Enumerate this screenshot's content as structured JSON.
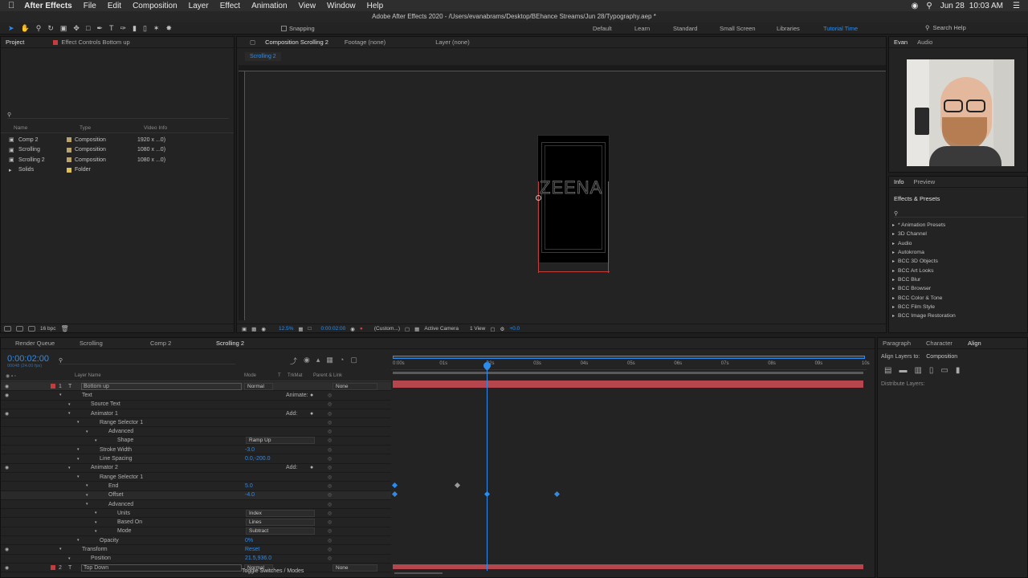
{
  "menubar": {
    "app": "After Effects",
    "items": [
      "File",
      "Edit",
      "Composition",
      "Layer",
      "Effect",
      "Animation",
      "View",
      "Window",
      "Help"
    ],
    "date": "Jun 28",
    "time": "10:03 AM"
  },
  "title": "Adobe After Effects 2020 - /Users/evanabrams/Desktop/BEhance Streams/Jun 28/Typography.aep *",
  "toolbar": {
    "snapping": "Snapping",
    "workspaces": [
      "Default",
      "Learn",
      "Standard",
      "Small Screen",
      "Libraries",
      "Tutorial Time"
    ],
    "search": "Search Help"
  },
  "project": {
    "tab": "Project",
    "effects_tab": "Effect Controls Bottom up",
    "cols": [
      "Name",
      "Type",
      "Video Info"
    ],
    "items": [
      {
        "name": "Comp 2",
        "type": "Composition",
        "info": "1920 x ...0)"
      },
      {
        "name": "Scrolling",
        "type": "Composition",
        "info": "1080 x ...0)"
      },
      {
        "name": "Scrolling 2",
        "type": "Composition",
        "info": "1080 x ...0)"
      },
      {
        "name": "Solids",
        "type": "Folder",
        "info": ""
      }
    ],
    "bpc": "16 bpc"
  },
  "comp": {
    "tab": "Composition Scrolling 2",
    "footage": "Footage (none)",
    "layer": "Layer (none)",
    "subtab": "Scrolling 2",
    "text": "ZEENA",
    "zoom": "12.5%",
    "timecode": "0:00:02:00",
    "res": "(Custom...)",
    "camera": "Active Camera",
    "view": "1 View",
    "exposure": "+0.0"
  },
  "right": {
    "user": "Evan",
    "audio": "Audio",
    "info": "Info",
    "preview": "Preview",
    "effects": "Effects & Presets",
    "presets": [
      "* Animation Presets",
      "3D Channel",
      "Audio",
      "Autokroma",
      "BCC 3D Objects",
      "BCC Art Looks",
      "BCC Blur",
      "BCC Browser",
      "BCC Color & Tone",
      "BCC Film Style",
      "BCC Image Restoration"
    ],
    "paragraph": "Paragraph",
    "character": "Character",
    "align": "Align",
    "align_to": "Align Layers to:",
    "align_val": "Composition",
    "distribute": "Distribute Layers:"
  },
  "timeline": {
    "tabs": [
      "Render Queue",
      "Scrolling",
      "Comp 2",
      "Scrolling 2"
    ],
    "timecode": "0:00:02:00",
    "frames": "00048 (24.00 fps)",
    "cols": [
      "Layer Name",
      "Mode",
      "T",
      "TrkMat",
      "Parent & Link"
    ],
    "ruler": [
      "0:00s",
      "01s",
      "02s",
      "03s",
      "04s",
      "05s",
      "06s",
      "07s",
      "08s",
      "09s",
      "10s"
    ],
    "rows": [
      {
        "indent": 0,
        "label": "Bottom up",
        "num": "1",
        "mode": "Normal",
        "parent": "None",
        "layer": true
      },
      {
        "indent": 1,
        "label": "Text",
        "right": "Animate:"
      },
      {
        "indent": 2,
        "label": "Source Text"
      },
      {
        "indent": 2,
        "label": "Animator 1",
        "right": "Add:"
      },
      {
        "indent": 3,
        "label": "Range Selector 1"
      },
      {
        "indent": 4,
        "label": "Advanced"
      },
      {
        "indent": 5,
        "label": "Shape",
        "val": "Ramp Up",
        "dd": true
      },
      {
        "indent": 3,
        "label": "Stroke Width",
        "val": "-3.0"
      },
      {
        "indent": 3,
        "label": "Line Spacing",
        "val": "0.0,-200.0"
      },
      {
        "indent": 2,
        "label": "Animator 2",
        "right": "Add:"
      },
      {
        "indent": 3,
        "label": "Range Selector 1"
      },
      {
        "indent": 4,
        "label": "End",
        "val": "5.0"
      },
      {
        "indent": 4,
        "label": "Offset",
        "val": "-4.0"
      },
      {
        "indent": 4,
        "label": "Advanced"
      },
      {
        "indent": 5,
        "label": "Units",
        "val": "Index",
        "dd": true
      },
      {
        "indent": 5,
        "label": "Based On",
        "val": "Lines",
        "dd": true
      },
      {
        "indent": 5,
        "label": "Mode",
        "val": "Subtract",
        "dd": true
      },
      {
        "indent": 3,
        "label": "Opacity",
        "val": "0%"
      },
      {
        "indent": 1,
        "label": "Transform",
        "val": "Reset"
      },
      {
        "indent": 2,
        "label": "Position",
        "val": "21.5,936.0"
      },
      {
        "indent": 0,
        "label": "Top Down",
        "num": "2",
        "mode": "Normal",
        "parent": "None",
        "layer": true
      }
    ],
    "footer": "Toggle Switches / Modes"
  },
  "colors": {
    "accent": "#2d8ceb",
    "layerbar": "#b5464d",
    "bg": "#1d1d1d"
  }
}
